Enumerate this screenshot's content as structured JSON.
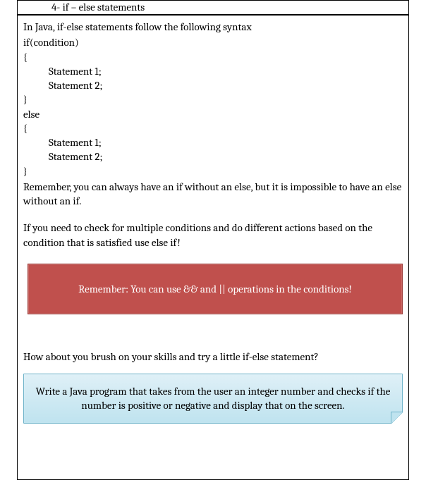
{
  "heading": "4-   if – else statements",
  "intro": "In Java, if-else statements follow the following syntax",
  "code": {
    "l1": "if(condition)",
    "l2": "{",
    "l3": "Statement 1;",
    "l4": "Statement 2;",
    "l5": "}",
    "l6": "else",
    "l7": "{",
    "l8": "Statement 1;",
    "l9": "Statement 2;",
    "l10": "}"
  },
  "remember": "Remember, you can always have an if without an else, but it is impossible to have an else without an if.",
  "multiconditions": "If you need to check for multiple conditions and do different actions based on the condition that is satisfied use else if!",
  "red_callout": "Remember: You can use && and || operations in the conditions!",
  "exercise_prompt": "How about you brush on your skills and try a little if-else statement?",
  "blue_callout": "Write a Java program that takes from the user an integer number and checks if the number is positive or negative and display that on the screen."
}
